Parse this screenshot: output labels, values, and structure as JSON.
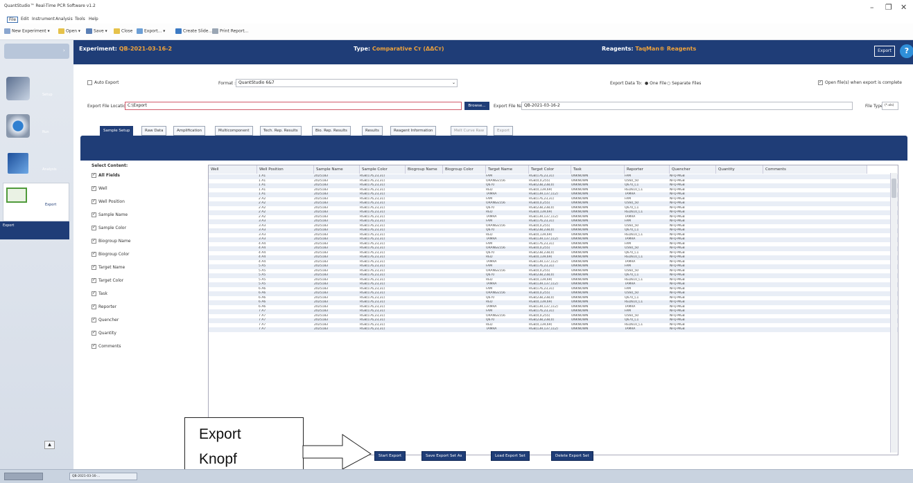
{
  "window": {
    "title": "QuantStudio™ Real-Time PCR Software v1.2"
  },
  "menu": [
    "File",
    "Edit",
    "Instrument",
    "Analysis",
    "Tools",
    "Help"
  ],
  "toolbar": [
    "New Experiment ▾",
    "Open ▾",
    "Save ▾",
    "Close",
    "Export... ▾",
    "Create Slide...",
    "Print Report..."
  ],
  "sidebar": [
    {
      "label": "Setup"
    },
    {
      "label": "Run"
    },
    {
      "label": "Analysis"
    },
    {
      "label": "Export"
    },
    {
      "label": "Export"
    }
  ],
  "header": {
    "experiment_label": "Experiment:",
    "experiment_value": "QB-2021-03-16-2",
    "type_label": "Type:",
    "type_value": "Comparative Cт (ΔΔCт)",
    "reagents_label": "Reagents:",
    "reagents_value": "TaqMan® Reagents",
    "export_btn": "Export",
    "help": "?"
  },
  "options": {
    "auto_export": "Auto Export",
    "format_label": "Format :",
    "format_value": "QuantStudio 6&7",
    "export_to_label": "Export Data To:",
    "one_file": "One File",
    "separate_files": "Separate Files",
    "open_file": "Open file(s) when export is complete",
    "location_label": "Export File Location:",
    "location_value": "C:\\Export",
    "browse": "Browse...",
    "filename_label": "Export File Name:",
    "filename_value": "QB-2021-03-16-2",
    "filetype_label": "File Type:",
    "filetype_value": "(*.xls)"
  },
  "tabs": [
    "Sample Setup",
    "Raw Data",
    "Amplification",
    "Multicomponent",
    "Tech. Rep. Results",
    "Bio. Rep. Results",
    "Results",
    "Reagent Information",
    "Melt Curve Raw",
    "Export"
  ],
  "select_content": {
    "title": "Select Content:",
    "items": [
      "All Fields",
      "Well",
      "Well Position",
      "Sample Name",
      "Sample Color",
      "Biogroup Name",
      "Biogroup Color",
      "Target Name",
      "Target Color",
      "Task",
      "Reporter",
      "Quencher",
      "Quantity",
      "Comments"
    ]
  },
  "grid": {
    "headers": [
      "Well",
      "Well Position",
      "Sample Name",
      "Sample Color",
      "Biogroup Name",
      "Biogroup Color",
      "Target Name",
      "Target Color",
      "Task",
      "Reporter",
      "Quencher",
      "Quantity",
      "Comments"
    ],
    "rows": [
      [
        "1 A1",
        "2025183",
        "RGB(176,23,31)",
        "FAM",
        "RGB(176,23,31)",
        "UNKNOWN",
        "FAM",
        "NFQ-MGB"
      ],
      [
        "1 A1",
        "2025183",
        "RGB(176,23,31)",
        "ORANGE556",
        "RGB(0,0,255)",
        "UNKNOWN",
        "O560_50",
        "NFQ-MGB"
      ],
      [
        "1 A1",
        "2025183",
        "RGB(176,23,31)",
        "Q670",
        "RGB(238,238,0)",
        "UNKNOWN",
        "Q670_C1",
        "NFQ-MGB"
      ],
      [
        "1 A1",
        "2025183",
        "RGB(176,23,31)",
        "RED",
        "RGB(0,139,69)",
        "UNKNOWN",
        "RED610_C1",
        "NFQ-MGB"
      ],
      [
        "1 A1",
        "2025183",
        "RGB(176,23,31)",
        "TAMRA",
        "RGB(139,137,112)",
        "UNKNOWN",
        "TAMRA",
        "NFQ-MGB"
      ],
      [
        "2 A2",
        "2025183",
        "RGB(176,23,31)",
        "FAM",
        "RGB(176,23,31)",
        "UNKNOWN",
        "FAM",
        "NFQ-MGB"
      ],
      [
        "2 A2",
        "2025183",
        "RGB(176,23,31)",
        "ORANGE556",
        "RGB(0,0,255)",
        "UNKNOWN",
        "O560_50",
        "NFQ-MGB"
      ],
      [
        "2 A2",
        "2025183",
        "RGB(176,23,31)",
        "Q670",
        "RGB(238,238,0)",
        "UNKNOWN",
        "Q670_C1",
        "NFQ-MGB"
      ],
      [
        "2 A2",
        "2025183",
        "RGB(176,23,31)",
        "RED",
        "RGB(0,139,69)",
        "UNKNOWN",
        "RED610_C1",
        "NFQ-MGB"
      ],
      [
        "2 A2",
        "2025183",
        "RGB(176,23,31)",
        "TAMRA",
        "RGB(139,137,112)",
        "UNKNOWN",
        "TAMRA",
        "NFQ-MGB"
      ],
      [
        "3 A3",
        "2025183",
        "RGB(176,23,31)",
        "FAM",
        "RGB(176,23,31)",
        "UNKNOWN",
        "FAM",
        "NFQ-MGB"
      ],
      [
        "3 A3",
        "2025183",
        "RGB(176,23,31)",
        "ORANGE556",
        "RGB(0,0,255)",
        "UNKNOWN",
        "O560_50",
        "NFQ-MGB"
      ],
      [
        "3 A3",
        "2025183",
        "RGB(176,23,31)",
        "Q670",
        "RGB(238,238,0)",
        "UNKNOWN",
        "Q670_C1",
        "NFQ-MGB"
      ],
      [
        "3 A3",
        "2025183",
        "RGB(176,23,31)",
        "RED",
        "RGB(0,139,69)",
        "UNKNOWN",
        "RED610_C1",
        "NFQ-MGB"
      ],
      [
        "3 A3",
        "2025183",
        "RGB(176,23,31)",
        "TAMRA",
        "RGB(139,137,112)",
        "UNKNOWN",
        "TAMRA",
        "NFQ-MGB"
      ],
      [
        "4 A4",
        "2025183",
        "RGB(176,23,31)",
        "FAM",
        "RGB(176,23,31)",
        "UNKNOWN",
        "FAM",
        "NFQ-MGB"
      ],
      [
        "4 A4",
        "2025183",
        "RGB(176,23,31)",
        "ORANGE556",
        "RGB(0,0,255)",
        "UNKNOWN",
        "O560_50",
        "NFQ-MGB"
      ],
      [
        "4 A4",
        "2025183",
        "RGB(176,23,31)",
        "Q670",
        "RGB(238,238,0)",
        "UNKNOWN",
        "Q670_C1",
        "NFQ-MGB"
      ],
      [
        "4 A4",
        "2025183",
        "RGB(176,23,31)",
        "RED",
        "RGB(0,139,69)",
        "UNKNOWN",
        "RED610_C1",
        "NFQ-MGB"
      ],
      [
        "4 A4",
        "2025183",
        "RGB(176,23,31)",
        "TAMRA",
        "RGB(139,137,112)",
        "UNKNOWN",
        "TAMRA",
        "NFQ-MGB"
      ],
      [
        "5 A5",
        "2025183",
        "RGB(176,23,31)",
        "FAM",
        "RGB(176,23,31)",
        "UNKNOWN",
        "FAM",
        "NFQ-MGB"
      ],
      [
        "5 A5",
        "2025183",
        "RGB(176,23,31)",
        "ORANGE556",
        "RGB(0,0,255)",
        "UNKNOWN",
        "O560_50",
        "NFQ-MGB"
      ],
      [
        "5 A5",
        "2025183",
        "RGB(176,23,31)",
        "Q670",
        "RGB(238,238,0)",
        "UNKNOWN",
        "Q670_C1",
        "NFQ-MGB"
      ],
      [
        "5 A5",
        "2025183",
        "RGB(176,23,31)",
        "RED",
        "RGB(0,139,69)",
        "UNKNOWN",
        "RED610_C1",
        "NFQ-MGB"
      ],
      [
        "5 A5",
        "2025183",
        "RGB(176,23,31)",
        "TAMRA",
        "RGB(139,137,112)",
        "UNKNOWN",
        "TAMRA",
        "NFQ-MGB"
      ],
      [
        "6 A6",
        "2025183",
        "RGB(176,23,31)",
        "FAM",
        "RGB(176,23,31)",
        "UNKNOWN",
        "FAM",
        "NFQ-MGB"
      ],
      [
        "6 A6",
        "2025183",
        "RGB(176,23,31)",
        "ORANGE556",
        "RGB(0,0,255)",
        "UNKNOWN",
        "O560_50",
        "NFQ-MGB"
      ],
      [
        "6 A6",
        "2025183",
        "RGB(176,23,31)",
        "Q670",
        "RGB(238,238,0)",
        "UNKNOWN",
        "Q670_C1",
        "NFQ-MGB"
      ],
      [
        "6 A6",
        "2025183",
        "RGB(176,23,31)",
        "RED",
        "RGB(0,139,69)",
        "UNKNOWN",
        "RED610_C1",
        "NFQ-MGB"
      ],
      [
        "6 A6",
        "2025183",
        "RGB(176,23,31)",
        "TAMRA",
        "RGB(139,137,112)",
        "UNKNOWN",
        "TAMRA",
        "NFQ-MGB"
      ],
      [
        "7 A7",
        "2025183",
        "RGB(176,23,31)",
        "FAM",
        "RGB(176,23,31)",
        "UNKNOWN",
        "FAM",
        "NFQ-MGB"
      ],
      [
        "7 A7",
        "2025183",
        "RGB(176,23,31)",
        "ORANGE556",
        "RGB(0,0,255)",
        "UNKNOWN",
        "O560_50",
        "NFQ-MGB"
      ],
      [
        "7 A7",
        "2025183",
        "RGB(176,23,31)",
        "Q670",
        "RGB(238,238,0)",
        "UNKNOWN",
        "Q670_C1",
        "NFQ-MGB"
      ],
      [
        "7 A7",
        "2025183",
        "RGB(176,23,31)",
        "RED",
        "RGB(0,139,69)",
        "UNKNOWN",
        "RED610_C1",
        "NFQ-MGB"
      ],
      [
        "7 A7",
        "2025183",
        "RGB(176,23,31)",
        "TAMRA",
        "RGB(139,137,112)",
        "UNKNOWN",
        "TAMRA",
        "NFQ-MGB"
      ]
    ]
  },
  "bottom_buttons": [
    "Start Export",
    "Save Export Set As",
    "Load Export Set",
    "Delete Export Set"
  ],
  "callout": {
    "line1": "Export",
    "line2": "Knopf"
  },
  "statusbar": {
    "tab": "QB-2021-03-16-..."
  },
  "colors": {
    "header_bg": "#1f3d77",
    "header_accent": "#f2a43a",
    "help_bg": "#2f8fd9"
  }
}
